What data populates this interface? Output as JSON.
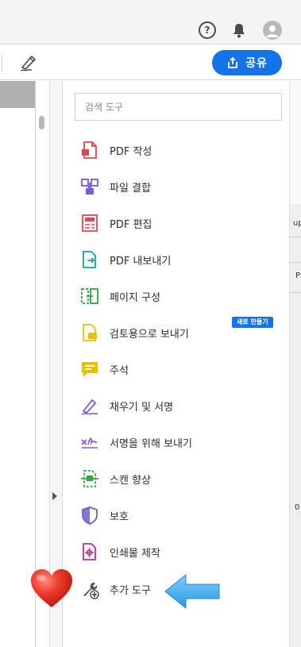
{
  "toolbar": {
    "share_label": "공유"
  },
  "icons": {
    "help": "help-circle-icon",
    "notifications": "bell-icon",
    "profile": "avatar-icon",
    "sign": "fill-sign-pen-icon",
    "share": "share-upload-icon"
  },
  "tools_panel": {
    "search_placeholder": "검색 도구",
    "new_badge": "새로 만들기",
    "items": [
      {
        "label": "PDF 작성",
        "color": "#e0474c"
      },
      {
        "label": "파일 결합",
        "color": "#7b5bd6"
      },
      {
        "label": "PDF 편집",
        "color": "#e34850"
      },
      {
        "label": "PDF 내보내기",
        "color": "#12a594"
      },
      {
        "label": "페이지 구성",
        "color": "#2eaa3f"
      },
      {
        "label": "검토용으로 보내기",
        "color": "#e8c200"
      },
      {
        "label": "주석",
        "color": "#e8c200"
      },
      {
        "label": "채우기 및 서명",
        "color": "#7b5bd6"
      },
      {
        "label": "서명을 위해 보내기",
        "color": "#7b5bd6"
      },
      {
        "label": "스캔 향상",
        "color": "#2eaa3f"
      },
      {
        "label": "보호",
        "color": "#6e5fd0"
      },
      {
        "label": "인쇄물 제작",
        "color": "#c2328e"
      },
      {
        "label": "추가 도구",
        "color": "#555555"
      }
    ]
  },
  "edge_window": {
    "text_top": "up",
    "text_mid": "P",
    "text_bottom": "0"
  },
  "colors": {
    "accent": "#1473e6",
    "annotation_arrow": "#4db4f0",
    "annotation_heart": "#e8322a"
  }
}
